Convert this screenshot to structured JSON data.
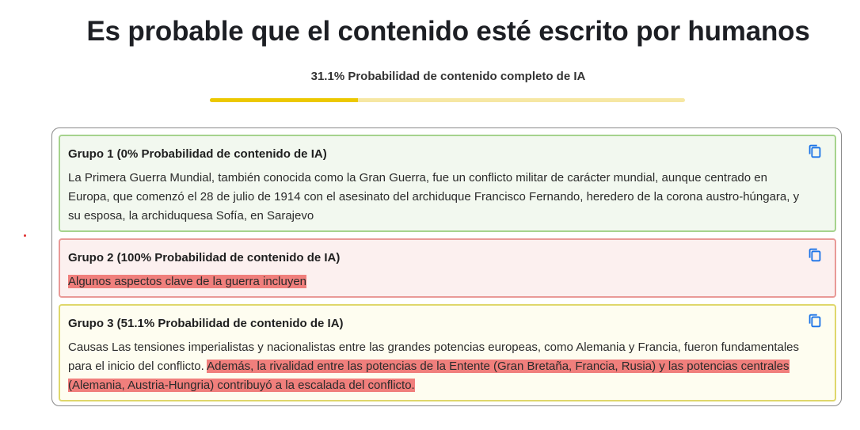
{
  "header": {
    "title": "Es probable que el contenido esté escrito por humanos",
    "summary": "31.1% Probabilidad de contenido completo de IA",
    "ai_probability": 0.311
  },
  "colors": {
    "accent_yellow": "#ecc800",
    "bar_track": "#f6e7a3",
    "green_border": "#a6d38d",
    "red_border": "#e99a97",
    "yellow_border": "#dfd76b",
    "highlight": "#f07f7c",
    "copy_icon": "#1a73e8"
  },
  "groups": [
    {
      "title": "Grupo 1 (0% Probabilidad de contenido de IA)",
      "text": "La Primera Guerra Mundial, también conocida como la Gran Guerra, fue un conflicto militar de carácter mundial, aunque centrado en Europa, que comenzó el 28 de julio de 1914 con el asesinato del archiduque Francisco Fernando, heredero de la corona austro-húngara, y su esposa, la archiduquesa Sofía, en Sarajevo",
      "copy_icon": "copy-icon"
    },
    {
      "title": "Grupo 2 (100% Probabilidad de contenido de IA)",
      "text_highlighted": "Algunos aspectos clave de la guerra incluyen",
      "copy_icon": "copy-icon"
    },
    {
      "title": "Grupo 3 (51.1% Probabilidad de contenido de IA)",
      "text_plain": "Causas Las tensiones imperialistas y nacionalistas entre las grandes potencias europeas, como Alemania y Francia, fueron fundamentales para el inicio del conflicto. ",
      "text_highlighted": "Además, la rivalidad entre las potencias de la Entente (Gran Bretaña, Francia, Rusia) y las potencias centrales (Alemania, Austria-Hungria) contribuyó a la escalada del conflicto.",
      "copy_icon": "copy-icon"
    }
  ]
}
